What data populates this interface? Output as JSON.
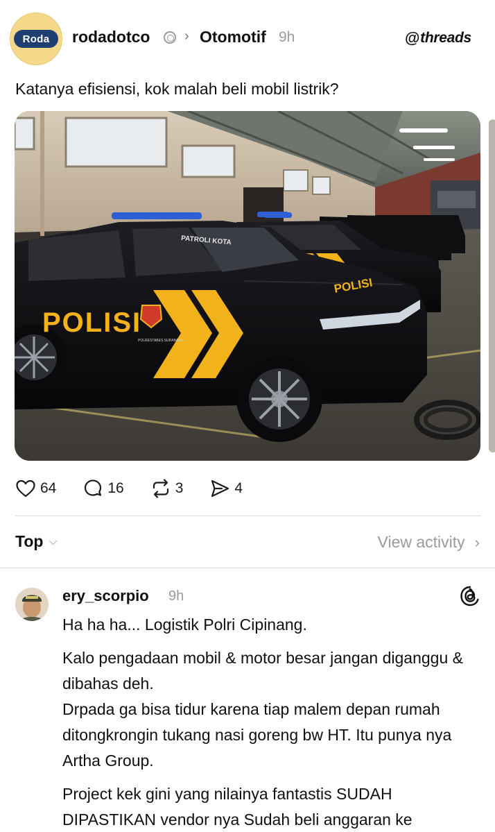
{
  "post": {
    "avatar_logo_text": "Roda",
    "username": "rodadotco",
    "topic": "Otomotif",
    "time": "9h",
    "brand": "threads",
    "brand_mark": "@",
    "caption": "Katanya efisiensi, kok malah beli mobil listrik?",
    "photo_texts": {
      "polisi_door": "POLISI",
      "polisi_hood": "POLISI",
      "windshield": "PATROLI KOTA",
      "door_small": "POLRESTABES SURABAYA"
    }
  },
  "actions": {
    "likes": "64",
    "replies": "16",
    "reposts": "3",
    "shares": "4"
  },
  "sort": {
    "label": "Top",
    "view_activity": "View activity"
  },
  "reply": {
    "username": "ery_scorpio",
    "time": "9h",
    "paragraphs": [
      "Ha ha ha... Logistik Polri Cipinang.",
      "Kalo pengadaan mobil &  motor besar jangan diganggu & dibahas deh.",
      "Drpada ga bisa tidur karena tiap malem depan rumah ditongkrongin tukang nasi goreng bw HT. Itu punya nya Artha Group.",
      "Project kek gini yang nilainya fantastis SUDAH DIPASTIKAN vendor nya Sudah beli anggaran ke"
    ]
  },
  "colors": {
    "text": "#101010",
    "muted": "#9a9a9a",
    "divider": "#dcdcdc",
    "police_yellow": "#f2b21b",
    "car_black": "#0e0e10"
  }
}
